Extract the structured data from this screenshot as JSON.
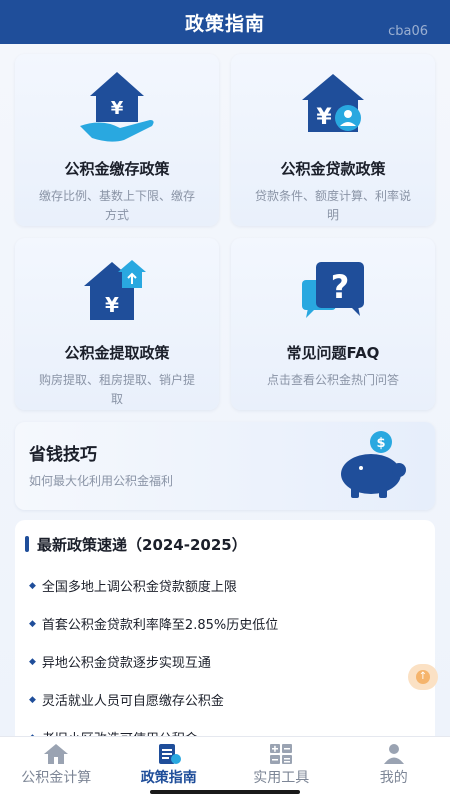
{
  "header": {
    "title": "政策指南",
    "watermark": "cba06"
  },
  "cards": [
    {
      "title": "公积金缴存政策",
      "desc": "缴存比例、基数上下限、缴存方式",
      "icon": "house-yen-hand-icon"
    },
    {
      "title": "公积金贷款政策",
      "desc": "贷款条件、额度计算、利率说明",
      "icon": "house-yen-person-icon"
    },
    {
      "title": "公积金提取政策",
      "desc": "购房提取、租房提取、销户提取",
      "icon": "house-yen-upload-icon"
    },
    {
      "title": "常见问题FAQ",
      "desc": "点击查看公积金热门问答",
      "icon": "question-chat-icon"
    }
  ],
  "tips": {
    "title": "省钱技巧",
    "desc": "如何最大化利用公积金福利",
    "icon": "piggy-bank-icon"
  },
  "news": {
    "title": "最新政策速递（2024-2025）",
    "items": [
      "全国多地上调公积金贷款额度上限",
      "首套公积金贷款利率降至2.85%历史低位",
      "异地公积金贷款逐步实现互通",
      "灵活就业人员可自愿缴存公积金",
      "老旧小区改造可使用公积金"
    ]
  },
  "tabbar": [
    {
      "label": "公积金计算",
      "icon": "house-icon",
      "active": false
    },
    {
      "label": "政策指南",
      "icon": "policy-doc-icon",
      "active": true
    },
    {
      "label": "实用工具",
      "icon": "calculator-icon",
      "active": false
    },
    {
      "label": "我的",
      "icon": "user-icon",
      "active": false
    }
  ],
  "colors": {
    "primary": "#1f4e9a",
    "accent": "#29a8e0",
    "background": "#eef3fb"
  }
}
